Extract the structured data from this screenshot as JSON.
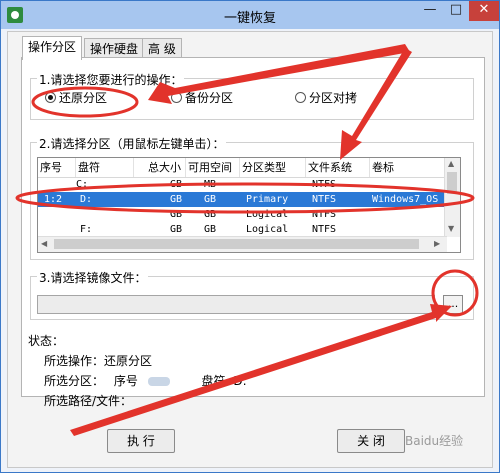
{
  "window": {
    "title": "一键恢复",
    "min_label": "—",
    "max_label": "□",
    "close_label": "✕"
  },
  "tabs": [
    "操作分区",
    "操作硬盘",
    "高 级"
  ],
  "section1": {
    "title": "1.请选择您要进行的操作：",
    "options": [
      "还原分区",
      "备份分区",
      "分区对拷"
    ],
    "selected": "还原分区"
  },
  "section2": {
    "title": "2.请选择分区（用鼠标左键单击）：",
    "columns": [
      "序号",
      "盘符",
      "总大小",
      "可用空间",
      "分区类型",
      "文件系统",
      "卷标"
    ],
    "rows": [
      [
        "",
        "C:",
        "GB",
        "MB",
        "",
        "NTFS",
        ""
      ],
      [
        "1:2",
        "D:",
        "GB",
        "GB",
        "Primary",
        "NTFS",
        "Windows7_OS"
      ],
      [
        "",
        "",
        "GB",
        "GB",
        "Logical",
        "NTFS",
        ""
      ],
      [
        "",
        "F:",
        "GB",
        "GB",
        "Logical",
        "NTFS",
        ""
      ]
    ],
    "selected_row": 1
  },
  "section3": {
    "title": "3.请选择镜像文件：",
    "file_path": "",
    "browse_label": "..."
  },
  "status": {
    "label": "状态：",
    "operation_label": "所选操作：",
    "operation_value": "还原分区",
    "partition_label": "所选分区：",
    "serial_label": "序号",
    "drive_label": "盘符",
    "drive_value": "D:",
    "path_label": "所选路径/文件："
  },
  "buttons": {
    "execute": "执 行",
    "close": "关 闭"
  },
  "watermark": "Baidu经验",
  "annotations": {
    "color": "#e2332b"
  }
}
